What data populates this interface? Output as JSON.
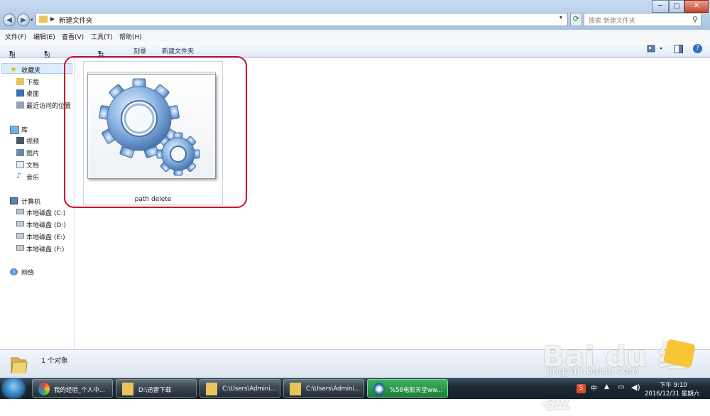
{
  "window": {
    "address_path": "新建文件夹",
    "search_placeholder": "搜索 新建文件夹",
    "buttons": {
      "minimize": "─",
      "maximize": "□",
      "close": "✕"
    }
  },
  "menubar": {
    "items": [
      "文件(F)",
      "编辑(E)",
      "查看(V)",
      "工具(T)",
      "帮助(H)"
    ]
  },
  "toolbar": {
    "organize": "组织",
    "include_library": "包含到库中",
    "share": "共享",
    "burn": "刻录",
    "new_folder": "新建文件夹"
  },
  "sidebar": {
    "favorites": {
      "label": "收藏夹",
      "items": [
        "下载",
        "桌面",
        "最近访问的位置"
      ]
    },
    "libraries": {
      "label": "库",
      "items": [
        "视频",
        "图片",
        "文档",
        "音乐"
      ]
    },
    "computer": {
      "label": "计算机",
      "items": [
        "本地磁盘 (C:)",
        "本地磁盘 (D:)",
        "本地磁盘 (E:)",
        "本地磁盘 (F:)"
      ]
    },
    "network": {
      "label": "网络"
    }
  },
  "content": {
    "file": {
      "name": "path  delete",
      "icon": "gears-icon"
    }
  },
  "statusbar": {
    "count": "1 个对象"
  },
  "watermark": {
    "brand": "Bai du 经验",
    "url": "jingyan.baidu.com"
  },
  "taskbar": {
    "items": [
      "我的经验_个人中...",
      "D:\\迅雷下载",
      "C:\\Users\\Admini...",
      "C:\\Users\\Admini...",
      "%58电影天堂ww..."
    ],
    "clock_time": "下午 9:10",
    "clock_date": "2016/12/31 星期六"
  },
  "colors": {
    "highlight": "#c8102e",
    "accent": "#2f7fbf"
  }
}
